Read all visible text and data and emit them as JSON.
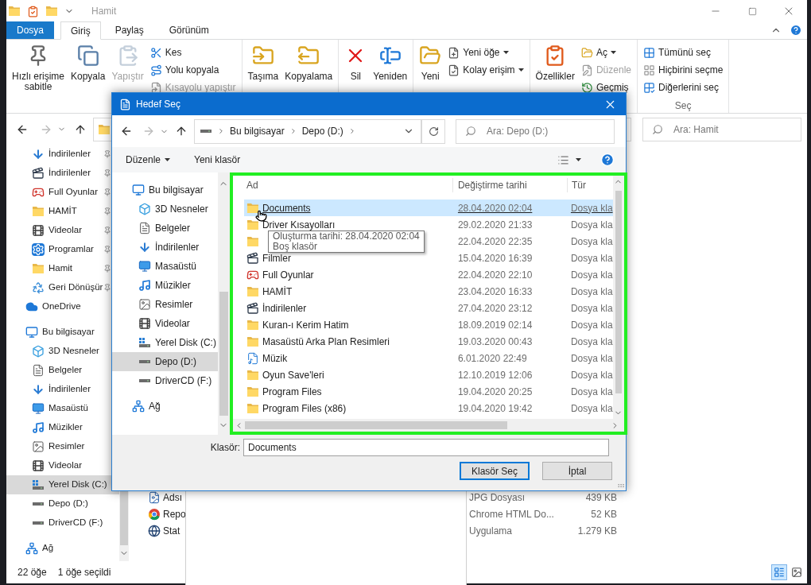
{
  "explorer": {
    "title": "Hamit",
    "tabs": [
      {
        "label": "Dosya",
        "kind": "file",
        "selected": false
      },
      {
        "label": "Giriş",
        "kind": "tab",
        "selected": true
      },
      {
        "label": "Paylaş",
        "kind": "tab",
        "selected": false
      },
      {
        "label": "Görünüm",
        "kind": "tab",
        "selected": false
      }
    ],
    "ribbon": [
      {
        "controls": [
          {
            "kind": "large",
            "label": "Hızlı erişime sabitle",
            "disabled": false
          },
          {
            "kind": "large",
            "label": "Kopyala",
            "disabled": false
          },
          {
            "kind": "large",
            "label": "Yapıştır",
            "disabled": true
          },
          {
            "kind": "stack",
            "items": [
              {
                "label": "Kes",
                "disabled": false,
                "dropdown": false
              },
              {
                "label": "Yolu kopyala",
                "disabled": false,
                "dropdown": false
              },
              {
                "label": "Kısayolu yapıştır",
                "disabled": true,
                "dropdown": false
              }
            ]
          }
        ]
      },
      {
        "controls": [
          {
            "kind": "large",
            "label": "Taşıma",
            "disabled": false
          },
          {
            "kind": "large",
            "label": "Kopyalama",
            "disabled": false
          }
        ]
      },
      {
        "controls": [
          {
            "kind": "large",
            "label": "Sil",
            "disabled": false
          },
          {
            "kind": "large",
            "label": "Yeniden",
            "disabled": false
          }
        ]
      },
      {
        "controls": [
          {
            "kind": "large",
            "label": "Yeni",
            "disabled": false
          },
          {
            "kind": "stack",
            "items": [
              {
                "label": "Yeni öğe",
                "disabled": false,
                "dropdown": true
              },
              {
                "label": "Kolay erişim",
                "disabled": false,
                "dropdown": true
              }
            ]
          }
        ]
      },
      {
        "controls": [
          {
            "kind": "large",
            "label": "Özellikler",
            "disabled": false
          },
          {
            "kind": "stack",
            "items": [
              {
                "label": "Aç",
                "disabled": false,
                "dropdown": true
              },
              {
                "label": "Düzenle",
                "disabled": true,
                "dropdown": false
              },
              {
                "label": "Geçmiş",
                "disabled": false,
                "dropdown": false
              }
            ]
          }
        ]
      },
      {
        "label": "Seç",
        "controls": [
          {
            "kind": "stack",
            "items": [
              {
                "label": "Tümünü seç",
                "disabled": false,
                "dropdown": false
              },
              {
                "label": "Hiçbirini seçme",
                "disabled": false,
                "dropdown": false
              },
              {
                "label": "Diğerlerini seç",
                "disabled": false,
                "dropdown": false
              }
            ]
          }
        ]
      }
    ],
    "search": {
      "placeholder": "Ara: Hamit"
    },
    "nav": [
      {
        "children": [
          {
            "label": "İndirilenler",
            "pinned": true,
            "selected": false
          },
          {
            "label": "İndirilenler",
            "pinned": true,
            "selected": false
          },
          {
            "label": "Full Oyunlar",
            "pinned": true,
            "selected": false
          },
          {
            "label": "HAMİT",
            "pinned": true,
            "selected": false
          },
          {
            "label": "Videolar",
            "pinned": true,
            "selected": false
          },
          {
            "label": "Programlar",
            "pinned": true,
            "selected": false
          },
          {
            "label": "Hamit",
            "pinned": true,
            "selected": false
          },
          {
            "label": "Geri Dönüşür",
            "pinned": true,
            "selected": false
          }
        ]
      },
      {
        "label": "OneDrive",
        "selected": false
      },
      {
        "label": "Bu bilgisayar",
        "selected": false,
        "children": [
          {
            "label": "3D Nesneler",
            "selected": false
          },
          {
            "label": "Belgeler",
            "selected": false
          },
          {
            "label": "İndirilenler",
            "selected": false
          },
          {
            "label": "Masaüstü",
            "selected": false
          },
          {
            "label": "Müzikler",
            "selected": false
          },
          {
            "label": "Resimler",
            "selected": false
          },
          {
            "label": "Videolar",
            "selected": false
          },
          {
            "label": "Yerel Disk (C:)",
            "selected": true
          },
          {
            "label": "Depo (D:)",
            "selected": false
          },
          {
            "label": "DriverCD (F:)",
            "selected": false
          }
        ]
      },
      {
        "label": "Ağ",
        "selected": false
      }
    ],
    "rows": [
      {
        "name": "Adsı",
        "type": "JPG Dosyası",
        "size": "439 KB"
      },
      {
        "name": "Repo",
        "type": "Chrome HTML Do...",
        "size": "52 KB"
      },
      {
        "name": "Stat",
        "type": "Uygulama",
        "size": "1.279 KB"
      }
    ],
    "status_bar": {
      "count": "22 öğe",
      "selection": "1 öğe seçildi",
      "views": [
        {
          "selected": true
        },
        {
          "selected": false
        }
      ]
    }
  },
  "dialog": {
    "title": "Hedef Seç",
    "address": [
      "Bu bilgisayar",
      "Depo (D:)"
    ],
    "search": {
      "placeholder": "Ara: Depo (D:)"
    },
    "toolbar": {
      "organize": "Düzenle",
      "new_folder": "Yeni klasör"
    },
    "tree": [
      {
        "label": "Bu bilgisayar",
        "selected": false,
        "children": [
          {
            "label": "3D Nesneler",
            "selected": false
          },
          {
            "label": "Belgeler",
            "selected": false
          },
          {
            "label": "İndirilenler",
            "selected": false
          },
          {
            "label": "Masaüstü",
            "selected": false
          },
          {
            "label": "Müzikler",
            "selected": false
          },
          {
            "label": "Resimler",
            "selected": false
          },
          {
            "label": "Videolar",
            "selected": false
          },
          {
            "label": "Yerel Disk (C:)",
            "selected": false
          },
          {
            "label": "Depo (D:)",
            "selected": true
          },
          {
            "label": "DriverCD (F:)",
            "selected": false
          }
        ]
      },
      {
        "label": "Ağ",
        "selected": false
      }
    ],
    "columns": [
      "Ad",
      "Değiştirme tarihi",
      "Tür"
    ],
    "files": [
      {
        "name": "Documents",
        "date": "28.04.2020 02:04",
        "type": "Dosya kla",
        "selected": true
      },
      {
        "name": "Driver Kısayolları",
        "date": "29.02.2020 21:33",
        "type": "Dosya kla",
        "selected": false
      },
      {
        "date": "22.04.2020 22:35",
        "type": "Dosya kla",
        "selected": false
      },
      {
        "name": "Filmler",
        "date": "15.04.2020 16:39",
        "type": "Dosya kla",
        "selected": false
      },
      {
        "name": "Full Oyunlar",
        "date": "22.04.2020 22:10",
        "type": "Dosya kla",
        "selected": false
      },
      {
        "name": "HAMİT",
        "date": "23.04.2020 16:33",
        "type": "Dosya kla",
        "selected": false
      },
      {
        "name": "İndirilenler",
        "date": "27.04.2020 23:12",
        "type": "Dosya kla",
        "selected": false
      },
      {
        "name": "Kuran-ı Kerim Hatim",
        "date": "18.09.2019 02:14",
        "type": "Dosya kla",
        "selected": false
      },
      {
        "name": "Masaüstü Arka Plan Resimleri",
        "date": "19.03.2020 00:43",
        "type": "Dosya kla",
        "selected": false
      },
      {
        "name": "Müzik",
        "date": "6.01.2020 22:49",
        "type": "Dosya kla",
        "selected": false
      },
      {
        "name": "Oyun Save'leri",
        "date": "12.10.2019 12:06",
        "type": "Dosya kla",
        "selected": false
      },
      {
        "name": "Program Files",
        "date": "19.04.2020 20:25",
        "type": "Dosya kla",
        "selected": false
      },
      {
        "name": "Program Files (x86)",
        "date": "19.04.2020 19:42",
        "type": "Dosya kla",
        "selected": false
      }
    ],
    "tooltip": [
      "Oluşturma tarihi: 28.04.2020 02:04",
      "Boş klasör"
    ],
    "folder_label": "Klasör:",
    "folder_value": "Documents",
    "buttons": [
      {
        "label": "Klasör Seç",
        "default": true
      },
      {
        "label": "İptal",
        "default": false
      }
    ]
  }
}
